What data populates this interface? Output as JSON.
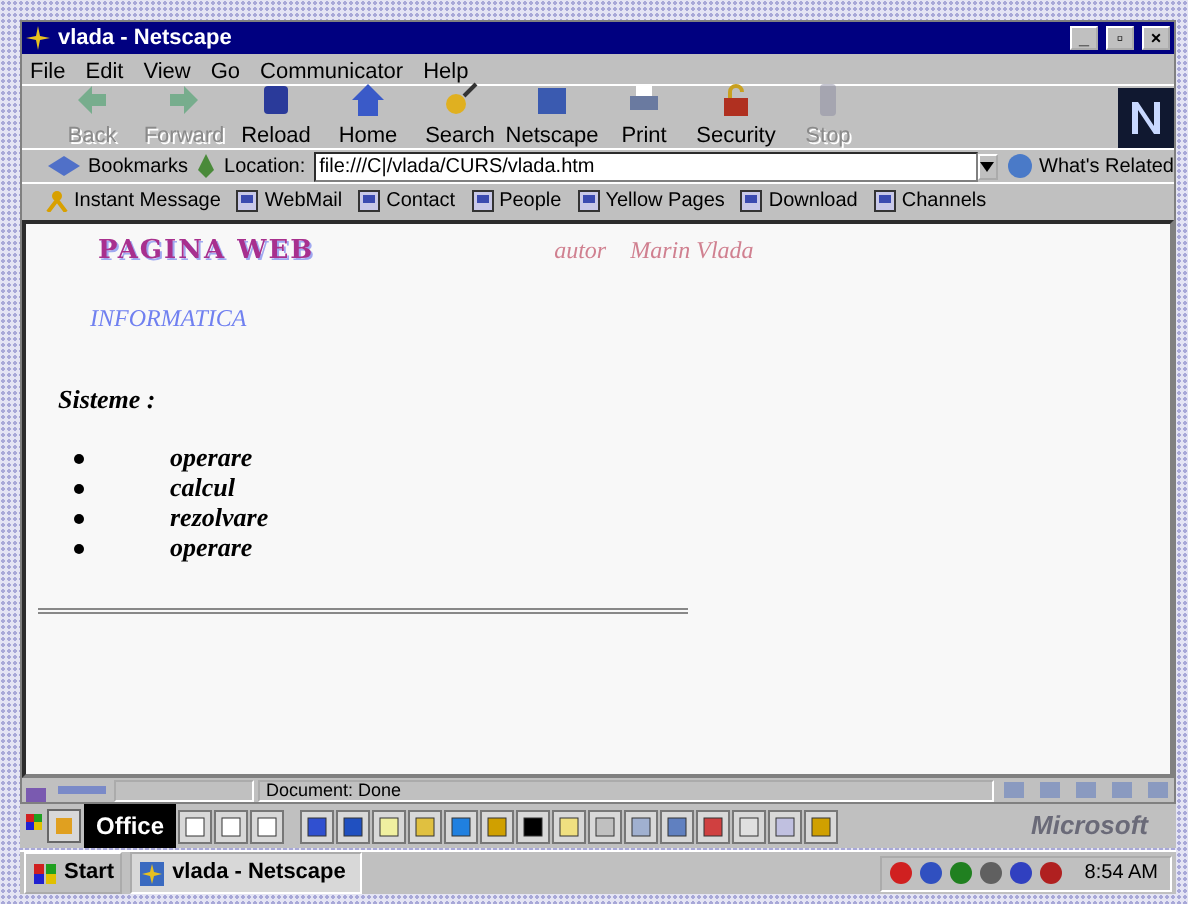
{
  "window": {
    "title": "vlada - Netscape",
    "controls": [
      "_",
      "▫",
      "×"
    ]
  },
  "menu": [
    "File",
    "Edit",
    "View",
    "Go",
    "Communicator",
    "Help"
  ],
  "toolbar": [
    {
      "label": "Back",
      "disabled": true
    },
    {
      "label": "Forward",
      "disabled": true
    },
    {
      "label": "Reload",
      "disabled": false
    },
    {
      "label": "Home",
      "disabled": false
    },
    {
      "label": "Search",
      "disabled": false
    },
    {
      "label": "Netscape",
      "disabled": false
    },
    {
      "label": "Print",
      "disabled": false
    },
    {
      "label": "Security",
      "disabled": false
    },
    {
      "label": "Stop",
      "disabled": true
    }
  ],
  "location_bar": {
    "bookmarks": "Bookmarks",
    "label": "Location:",
    "url": "file:///C|/vlada/CURS/vlada.htm",
    "related": "What's Related"
  },
  "personal_bar": [
    "Instant Message",
    "WebMail",
    "Contact",
    "People",
    "Yellow Pages",
    "Download",
    "Channels"
  ],
  "page": {
    "title": "PAGINA WEB",
    "author_label": "autor",
    "author": "Marin Vlada",
    "subtitle": "INFORMATICA",
    "heading": "Sisteme :",
    "items": [
      "operare",
      "calcul",
      "rezolvare",
      "operare"
    ]
  },
  "status_bar": {
    "text": "Document: Done"
  },
  "office_bar": {
    "label": "Office",
    "brand": "Microsoft"
  },
  "taskbar": {
    "start": "Start",
    "tasks": [
      {
        "label": "vlada - Netscape",
        "selected": true
      }
    ],
    "clock": "8:54 AM"
  }
}
